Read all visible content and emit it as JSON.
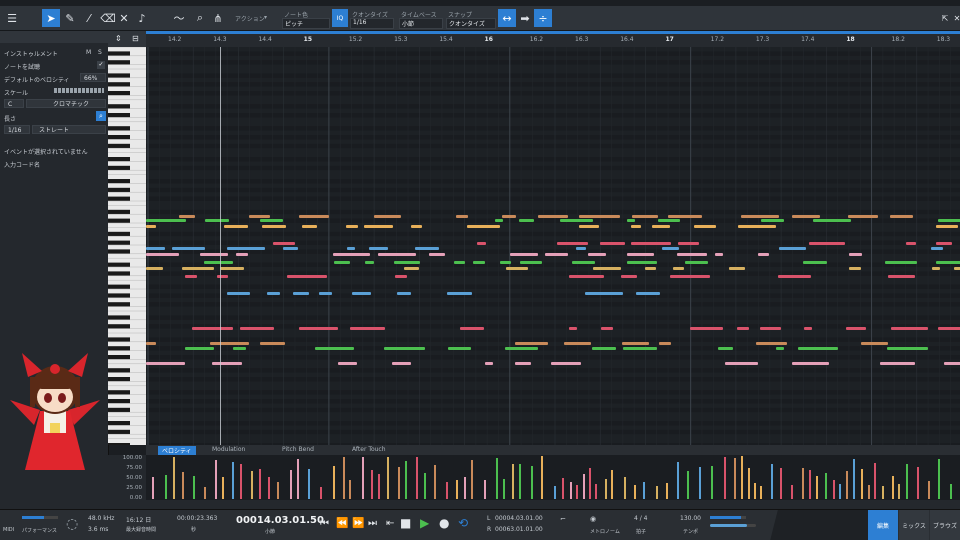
{
  "toolbar": {
    "menu_icon": "hamburger-icon",
    "action_label": "アクション",
    "note_color_label": "ノート色",
    "note_color_value": "ピッチ",
    "quantize_label": "クオンタイズ",
    "quantize_value": "1/16",
    "timebase_label": "タイムベース",
    "timebase_value": "小節",
    "snap_label": "スナップ",
    "snap_value": "クオンタイズ",
    "iq_label": "IQ"
  },
  "inspector": {
    "instrument_label": "インストゥルメント",
    "m_label": "M",
    "s_label": "S",
    "note_audition_label": "ノートを試聴",
    "default_velocity_label": "デフォルトのベロシティ",
    "default_velocity_value": "66%",
    "scale_label": "スケール",
    "scale_root": "C",
    "scale_type": "クロマチック",
    "length_label": "長さ",
    "length_value": "1/16",
    "length_mode": "ストレート",
    "no_event_text": "イベントが選択されていません",
    "input_code_label": "入力コード名"
  },
  "ruler": {
    "ticks": [
      "14.2",
      "14.3",
      "14.4",
      "15",
      "15.2",
      "15.3",
      "15.4",
      "16",
      "16.2",
      "16.3",
      "16.4",
      "17",
      "17.2",
      "17.3",
      "17.4",
      "18",
      "18.2",
      "18.3"
    ],
    "major": [
      "15",
      "16",
      "17",
      "18"
    ]
  },
  "lane_tabs": [
    "ベロシティ",
    "Modulation",
    "Pitch Bend",
    "After Touch"
  ],
  "velocity_scale": [
    "100.00",
    "75.00",
    "50.00",
    "25.00",
    "0.00"
  ],
  "transport": {
    "midi_label": "MIDI",
    "performance_label": "パフォーマンス",
    "sample_rate": "48.0 kHz",
    "latency": "3.6 ms",
    "record_time": "16:12 日",
    "record_max_label": "最大録音時間",
    "time_seconds": "00:00:23.363",
    "seconds_label": "秒",
    "position": "00014.03.01.50",
    "bars_label": "小節",
    "loop_l": "00004.03.01.00",
    "loop_r": "00063.01.01.00",
    "l_label": "L",
    "r_label": "R",
    "metronome_label": "メトロノーム",
    "time_sig": "4 / 4",
    "time_sig_label": "拍子",
    "tempo": "130.00",
    "tempo_label": "テンポ",
    "pages": [
      "編集",
      "ミックス",
      "ブラウズ"
    ]
  },
  "colors": {
    "accent": "#2d7fd3",
    "note_palette": [
      "#d9536b",
      "#e4a0b8",
      "#5aa0d6",
      "#d6b060",
      "#4cbf4f",
      "#e8b05a",
      "#c98a5a"
    ]
  }
}
